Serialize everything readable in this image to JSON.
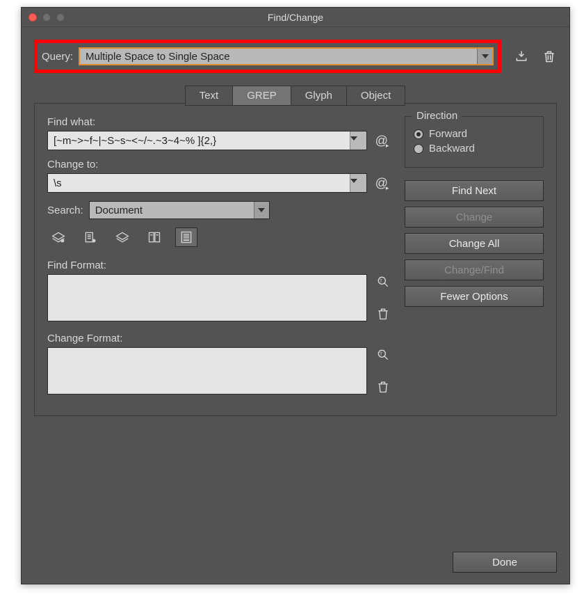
{
  "window": {
    "title": "Find/Change"
  },
  "query": {
    "label": "Query:",
    "selected": "Multiple Space to Single Space"
  },
  "tabs": [
    {
      "label": "Text",
      "active": false
    },
    {
      "label": "GREP",
      "active": true
    },
    {
      "label": "Glyph",
      "active": false
    },
    {
      "label": "Object",
      "active": false
    }
  ],
  "find": {
    "label": "Find what:",
    "value": "[~m~>~f~|~S~s~<~/~.~3~4~% ]{2,}"
  },
  "change": {
    "label": "Change to:",
    "value": "\\s"
  },
  "search": {
    "label": "Search:",
    "selected": "Document"
  },
  "findFormat": {
    "label": "Find Format:"
  },
  "changeFormat": {
    "label": "Change Format:"
  },
  "direction": {
    "legend": "Direction",
    "forward": "Forward",
    "backward": "Backward",
    "selected": "forward"
  },
  "buttons": {
    "findNext": "Find Next",
    "change": "Change",
    "changeAll": "Change All",
    "changeFind": "Change/Find",
    "fewerOptions": "Fewer Options",
    "done": "Done"
  }
}
